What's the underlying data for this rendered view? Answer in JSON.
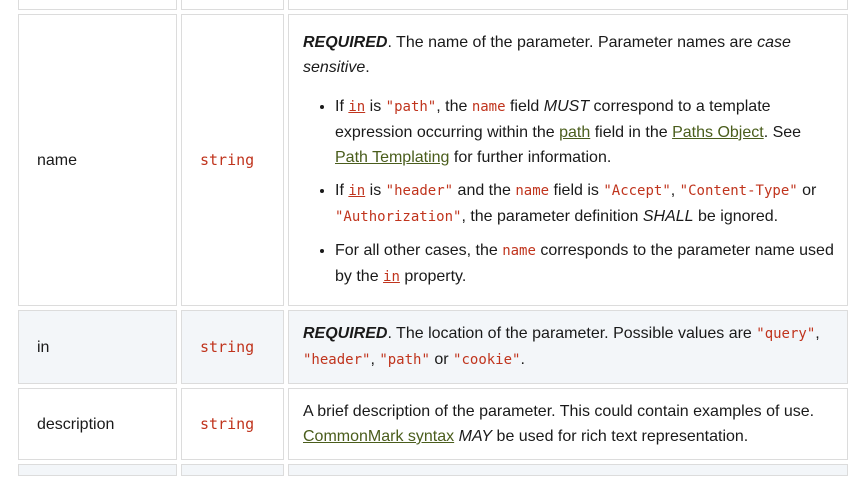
{
  "rows": [
    {
      "name": "name",
      "type": "string",
      "required_label": "REQUIRED",
      "desc_intro": ". The name of the parameter. Parameter names are ",
      "desc_case": "case sensitive",
      "desc_end": ".",
      "bullets": [
        {
          "p1": "If ",
          "in": "in",
          "p2": " is ",
          "code1": "\"path\"",
          "p3": ", the ",
          "code2": "name",
          "p4": " field ",
          "must": "MUST",
          "p5": " correspond to a template expression occurring within the ",
          "link_path": "path",
          "p6": " field in the ",
          "link_paths_object": "Paths Object",
          "p7": ". See ",
          "link_templating": "Path Templating",
          "p8": " for further information."
        },
        {
          "p1": "If ",
          "in": "in",
          "p2": " is ",
          "code1": "\"header\"",
          "p3": " and the ",
          "code2": "name",
          "p4": " field is ",
          "code3": "\"Accept\"",
          "p5": ", ",
          "code4": "\"Content-Type\"",
          "p6": " or ",
          "code5": "\"Authorization\"",
          "p7": ", the parameter definition ",
          "shall": "SHALL",
          "p8": " be ignored."
        },
        {
          "p1": "For all other cases, the ",
          "code1": "name",
          "p2": " corresponds to the parameter name used by the ",
          "in": "in",
          "p3": " property."
        }
      ]
    },
    {
      "name": "in",
      "type": "string",
      "required_label": "REQUIRED",
      "desc": ". The location of the parameter. Possible values are ",
      "v1": "\"query\"",
      "s1": ", ",
      "v2": "\"header\"",
      "s2": ", ",
      "v3": "\"path\"",
      "s3": " or ",
      "v4": "\"cookie\"",
      "s4": "."
    },
    {
      "name": "description",
      "type": "string",
      "desc": "A brief description of the parameter. This could contain examples of use. ",
      "link": "CommonMark syntax",
      "may": "MAY",
      "desc_end": " be used for rich text representation."
    }
  ]
}
